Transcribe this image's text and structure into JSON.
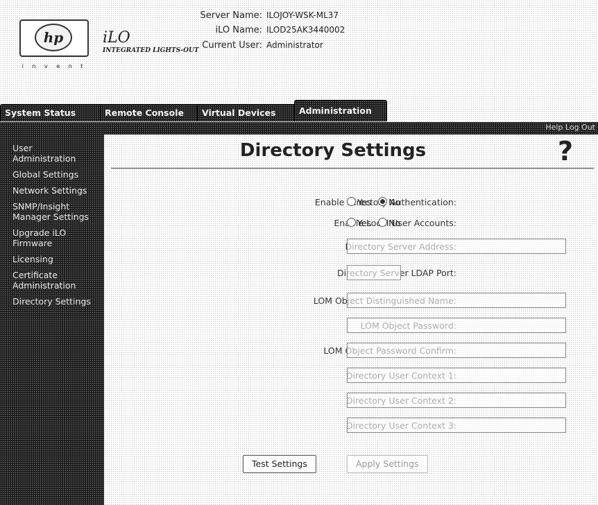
{
  "header": {
    "hp_logo_text": "hp",
    "hp_invent": "i n v e n t",
    "ilo_logo": "iLO",
    "ilo_subtitle": "INTEGRATED LIGHTS-OUT",
    "server_name_label": "Server Name:",
    "server_name_value": "ILOJOY-WSK-ML37",
    "ilo_name_label": "iLO Name:",
    "ilo_name_value": "ILOD25AK3440002",
    "current_user_label": "Current User:",
    "current_user_value": "Administrator"
  },
  "tabs": [
    {
      "label": "System Status"
    },
    {
      "label": "Remote Console"
    },
    {
      "label": "Virtual Devices"
    },
    {
      "label": "Administration",
      "active": true
    }
  ],
  "subnav": {
    "links": "Help Log Out"
  },
  "sidebar": {
    "items": [
      {
        "label": "User Administration"
      },
      {
        "label": "Global Settings"
      },
      {
        "label": "Network Settings"
      },
      {
        "label": "SNMP/Insight Manager Settings"
      },
      {
        "label": "Upgrade iLO Firmware"
      },
      {
        "label": "Licensing"
      },
      {
        "label": "Certificate Administration"
      },
      {
        "label": "Directory Settings"
      }
    ]
  },
  "main": {
    "title": "Directory Settings",
    "help_icon": "?",
    "fields": {
      "enable_dir_auth": {
        "label": "Enable Directory Authentication:",
        "options": [
          "Yes",
          "No"
        ],
        "selected": "No"
      },
      "enable_local_accounts": {
        "label": "Enable Local User Accounts:",
        "options": [
          "Yes",
          "No"
        ],
        "selected": null
      },
      "dir_server_address": {
        "label": "Directory Server Address:",
        "value": ""
      },
      "dir_server_ldap_port": {
        "label": "Directory Server LDAP Port:",
        "value": ""
      },
      "lom_dn": {
        "label": "LOM Object Distinguished Name:",
        "value": ""
      },
      "lom_password": {
        "label": "LOM Object Password:",
        "value": ""
      },
      "lom_password_confirm": {
        "label": "LOM Object Password Confirm:",
        "value": ""
      },
      "user_context_1": {
        "label": "Directory User Context 1:",
        "value": ""
      },
      "user_context_2": {
        "label": "Directory User Context 2:",
        "value": ""
      },
      "user_context_3": {
        "label": "Directory User Context 3:",
        "value": ""
      }
    },
    "buttons": {
      "test_settings": "Test Settings",
      "apply_settings": "Apply Settings"
    }
  },
  "colors": {
    "dark_panel": "#1e1e1e",
    "panel_text": "#f4f4f4"
  }
}
